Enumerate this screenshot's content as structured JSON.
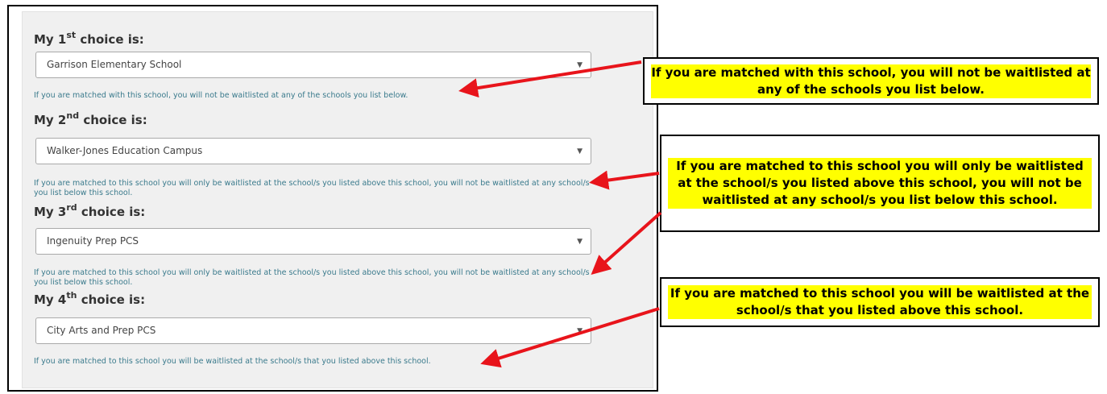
{
  "choices": [
    {
      "prefix": "My 1",
      "suffix": "st",
      "label_end": " choice is:",
      "value": "Garrison Elementary School",
      "help": "If you are matched with this school, you will not be waitlisted at any of the schools you list below."
    },
    {
      "prefix": "My 2",
      "suffix": "nd",
      "label_end": " choice is:",
      "value": "Walker-Jones Education Campus",
      "help": "If you are matched to this school you will only be waitlisted at the school/s you listed above this school, you will not be waitlisted at any school/s you list below this school."
    },
    {
      "prefix": "My 3",
      "suffix": "rd",
      "label_end": " choice is:",
      "value": "Ingenuity Prep PCS",
      "help": "If you are matched to this school you will only be waitlisted at the school/s you listed above this school, you will not be waitlisted at any school/s you list below this school."
    },
    {
      "prefix": "My 4",
      "suffix": "th",
      "label_end": " choice is:",
      "value": "City Arts and Prep PCS",
      "help": "If you are matched to this school you will be waitlisted at the school/s that you listed above this school."
    }
  ],
  "callouts": [
    "If you are matched with this school, you will not be waitlisted at any of the schools you list below.",
    "If you are matched to this school you will only be waitlisted at the school/s you listed above this school, you will not be waitlisted at any school/s you list below this school.",
    "If you are matched to this school you will be waitlisted at the school/s that you listed above this school."
  ],
  "colors": {
    "highlight": "#ffff00",
    "arrow": "#e8141b",
    "help_text": "#3a7a8c"
  },
  "icons": {
    "select_caret": "caret-down-icon"
  }
}
